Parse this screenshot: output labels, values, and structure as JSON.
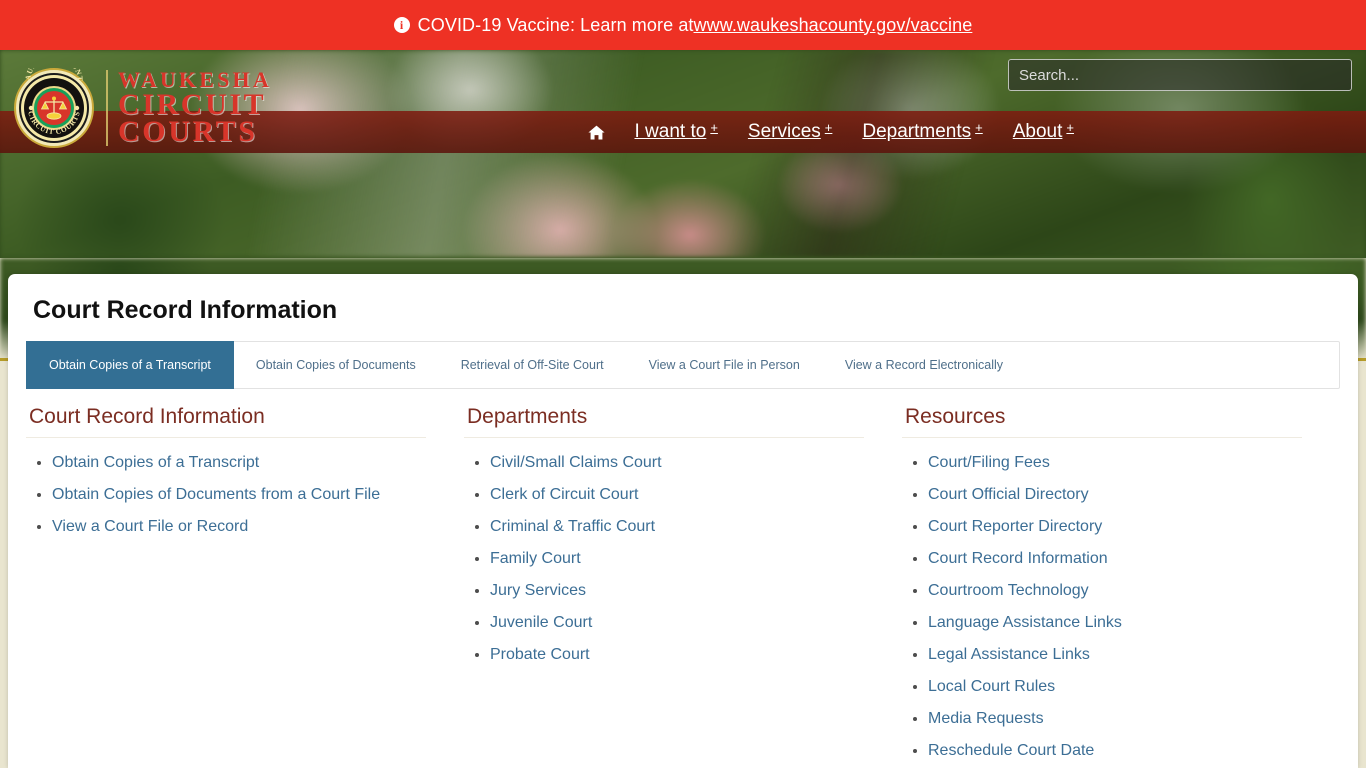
{
  "alert": {
    "icon": "info-circle-icon",
    "text_before": "COVID-19 Vaccine: Learn more at ",
    "link_text": "www.waukeshacounty.gov/vaccine",
    "background_color": "#ee3124"
  },
  "header": {
    "seal": {
      "top_text": "WAUKESHA COUNTY",
      "bottom_text": "CIRCUIT COURTS",
      "emblem": "scales-of-justice-icon"
    },
    "wordmark": {
      "line1": "WAUKESHA",
      "line2": "CIRCUIT",
      "line3": "COURTS",
      "color": "#d8352a"
    },
    "search": {
      "placeholder": "Search...",
      "value": ""
    },
    "nav": {
      "home_icon": "home-icon",
      "items": [
        {
          "label": "I want to",
          "indicator": "+"
        },
        {
          "label": "Services",
          "indicator": "+"
        },
        {
          "label": "Departments",
          "indicator": "+"
        },
        {
          "label": "About",
          "indicator": "+"
        }
      ]
    }
  },
  "main": {
    "page_title": "Court Record Information",
    "tabs": [
      {
        "label": "Obtain Copies of a Transcript",
        "active": true
      },
      {
        "label": "Obtain Copies of Documents",
        "active": false
      },
      {
        "label": "Retrieval of Off-Site Court",
        "active": false
      },
      {
        "label": "View a Court File in Person",
        "active": false
      },
      {
        "label": "View a Record Electronically",
        "active": false
      }
    ],
    "active_tab_color": "#336f94",
    "columns": [
      {
        "heading": "Court Record Information",
        "links": [
          "Obtain Copies of a Transcript",
          "Obtain Copies of Documents from a Court File",
          "View a Court File or Record"
        ]
      },
      {
        "heading": "Departments",
        "links": [
          "Civil/Small Claims Court",
          "Clerk of Circuit Court",
          "Criminal & Traffic Court",
          "Family Court",
          "Jury Services",
          "Juvenile Court",
          "Probate Court"
        ]
      },
      {
        "heading": "Resources",
        "links": [
          "Court/Filing Fees",
          "Court Official Directory",
          "Court Reporter Directory",
          "Court Record Information",
          "Courtroom Technology",
          "Language Assistance Links",
          "Legal Assistance Links",
          "Local Court Rules",
          "Media Requests",
          "Reschedule Court Date"
        ]
      }
    ],
    "heading_color": "#7b2d22",
    "link_color": "#3c6e95"
  }
}
